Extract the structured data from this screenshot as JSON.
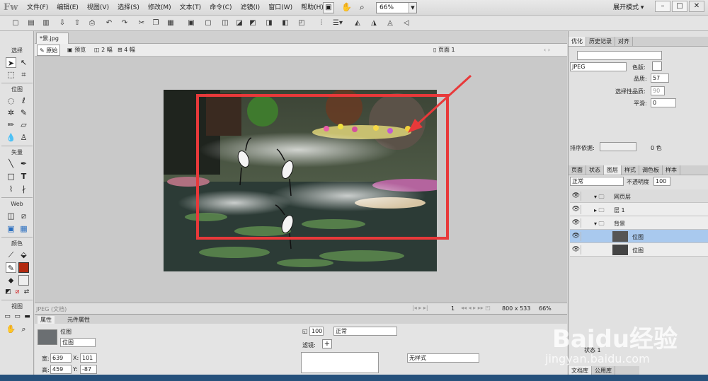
{
  "app": {
    "logo": "Fw"
  },
  "menu": [
    "文件(F)",
    "编辑(E)",
    "视图(V)",
    "选择(S)",
    "修改(M)",
    "文本(T)",
    "命令(C)",
    "滤镜(I)",
    "窗口(W)",
    "帮助(H)"
  ],
  "zoom_top": "66%",
  "workspace": "展开模式",
  "doc_tab": "*景.jpg",
  "view_modes": [
    "原始",
    "预览",
    "2 幅",
    "4 幅"
  ],
  "page_label": "页面 1",
  "left_tools": {
    "sections": [
      "选择",
      "位图",
      "矢量",
      "Web",
      "颜色",
      "视图"
    ]
  },
  "status": {
    "filetype": "JPEG (文档)",
    "frame": "1",
    "size": "800 x 533",
    "zoom": "66%"
  },
  "properties": {
    "tabs": [
      "属性",
      "元件属性"
    ],
    "object_type": "位图",
    "object_name": "位图",
    "width_label": "宽:",
    "width": "639",
    "height_label": "高:",
    "height": "459",
    "x_label": "X:",
    "x": "101",
    "y_label": "Y:",
    "y": "-87",
    "opacity": "100",
    "blend": "正常",
    "filters_label": "滤镜:",
    "style": "无样式"
  },
  "optimize_panel": {
    "tabs": [
      "优化",
      "历史记录",
      "对齐"
    ],
    "format": "JPEG",
    "quality_color_label": "色版:",
    "quality_label": "品质:",
    "quality": "57",
    "selective_label": "选择性品质:",
    "selective": "90",
    "smooth_label": "平滑:",
    "smooth": "0",
    "sort_label": "排序依据:",
    "colors": "0 色"
  },
  "layers_panel": {
    "tabs": [
      "页面",
      "状态",
      "图层",
      "样式",
      "调色板",
      "样本"
    ],
    "blend": "正常",
    "opacity_label": "不透明度",
    "opacity": "100",
    "rows": [
      {
        "name": "网页层",
        "type": "folder"
      },
      {
        "name": "层 1",
        "type": "folder"
      },
      {
        "name": "背景",
        "type": "folder"
      },
      {
        "name": "位图",
        "type": "bitmap",
        "selected": true
      },
      {
        "name": "位图",
        "type": "bitmap",
        "selected": false
      }
    ],
    "state_label": "状态 1"
  },
  "bottom_tabs": [
    "文档库",
    "公用库"
  ],
  "watermark": {
    "brand": "Baidu经验",
    "url": "jingyan.baidu.com"
  },
  "colors": {
    "accent_red": "#e8393a",
    "selection_blue": "#a9c9ee"
  }
}
